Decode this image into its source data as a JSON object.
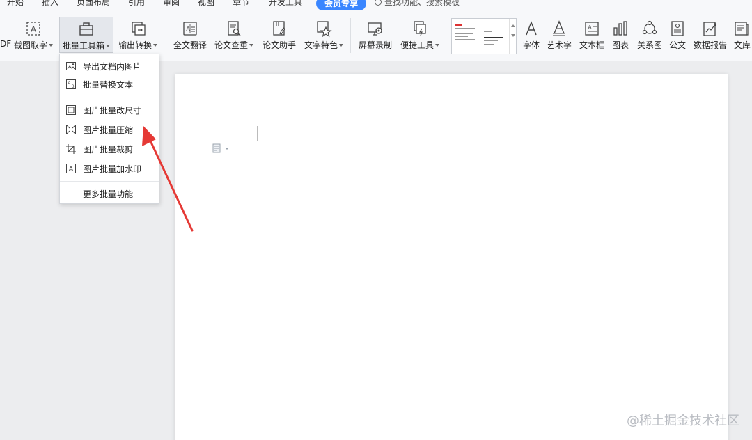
{
  "tabs": [
    {
      "label": "开始",
      "active": false
    },
    {
      "label": "插入",
      "active": false
    },
    {
      "label": "页面布局",
      "active": false
    },
    {
      "label": "引用",
      "active": false
    },
    {
      "label": "审阅",
      "active": false
    },
    {
      "label": "视图",
      "active": false
    },
    {
      "label": "章节",
      "active": false
    },
    {
      "label": "开发工具",
      "active": false
    },
    {
      "label": "会员专享",
      "active": true
    }
  ],
  "search": {
    "label": "查找功能、搜索模板"
  },
  "ribbon": {
    "pdf_fragment": "DF",
    "screenshot_ocr": "截图取字",
    "batch_tools": "批量工具箱",
    "output_convert": "输出转换",
    "full_translate": "全文翻译",
    "paper_check": "论文查重",
    "paper_assistant": "论文助手",
    "text_effects": "文字特色",
    "screen_record": "屏幕录制",
    "quick_tools": "便捷工具",
    "font": "字体",
    "art_text": "艺术字",
    "text_box": "文本框",
    "chart": "图表",
    "relation_chart": "关系图",
    "official_doc": "公文",
    "data_report": "数据报告",
    "library": "文库"
  },
  "batch_menu": {
    "items": [
      {
        "label": "导出文档内图片",
        "icon": "export-image-icon"
      },
      {
        "label": "批量替换文本",
        "icon": "replace-text-icon"
      },
      {
        "label": "图片批量改尺寸",
        "icon": "resize-image-icon"
      },
      {
        "label": "图片批量压缩",
        "icon": "compress-image-icon"
      },
      {
        "label": "图片批量裁剪",
        "icon": "crop-image-icon"
      },
      {
        "label": "图片批量加水印",
        "icon": "watermark-image-icon"
      }
    ],
    "more": "更多批量功能"
  },
  "annotation": {
    "arrow_color": "#e53935"
  },
  "watermark": "@稀土掘金技术社区",
  "colors": {
    "accent": "#3a86ff",
    "ribbon_bg": "#f7f8fa",
    "canvas_bg": "#ecedef"
  }
}
